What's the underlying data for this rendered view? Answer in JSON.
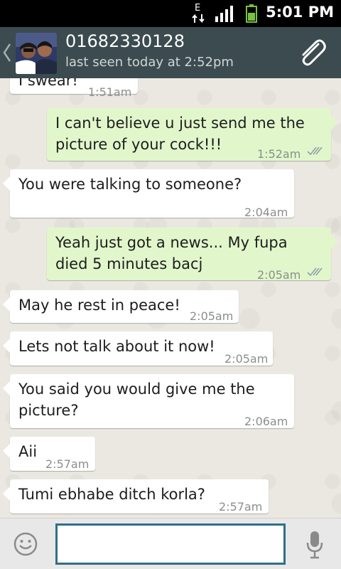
{
  "status_bar": {
    "time": "5:01 PM",
    "network_type": "E",
    "icons": [
      "data-arrows-icon",
      "signal-icon",
      "battery-icon"
    ]
  },
  "header": {
    "contact_name": "01682330128",
    "last_seen": "last seen today at 2:52pm",
    "icons": [
      "back-chevron-icon",
      "avatar",
      "paperclip-icon"
    ]
  },
  "messages": [
    {
      "direction": "in",
      "text_lines": [
        "I swear!"
      ],
      "time": "1:51am"
    },
    {
      "direction": "out",
      "text_lines": [
        "I can't believe u just send me the",
        "picture of your cock!!!"
      ],
      "time": "1:52am",
      "status": "read"
    },
    {
      "direction": "in",
      "text_lines": [
        "You were talking to someone?"
      ],
      "time": "2:04am"
    },
    {
      "direction": "out",
      "text_lines": [
        "Yeah just got a news... My fupa",
        "died 5 minutes bacj"
      ],
      "time": "2:05am",
      "status": "read"
    },
    {
      "direction": "in",
      "text_lines": [
        "May he rest in peace!"
      ],
      "time": "2:05am"
    },
    {
      "direction": "in",
      "text_lines": [
        "Lets not talk about it now!"
      ],
      "time": "2:05am"
    },
    {
      "direction": "in",
      "text_lines": [
        "You said you would give me the",
        "picture?"
      ],
      "time": "2:06am"
    },
    {
      "direction": "in",
      "text_lines": [
        "Aii"
      ],
      "time": "2:57am"
    },
    {
      "direction": "in",
      "text_lines": [
        "Tumi ebhabe ditch korla?"
      ],
      "time": "2:57am"
    }
  ],
  "input_bar": {
    "value": "",
    "icons": [
      "emoji-icon",
      "microphone-icon"
    ]
  },
  "colors": {
    "header_bg": "#3b4b4f",
    "incoming_bubble": "#ffffff",
    "outgoing_bubble": "#e1f7cb",
    "input_border": "#2f6f86",
    "ticks": "#8fa3a8"
  }
}
